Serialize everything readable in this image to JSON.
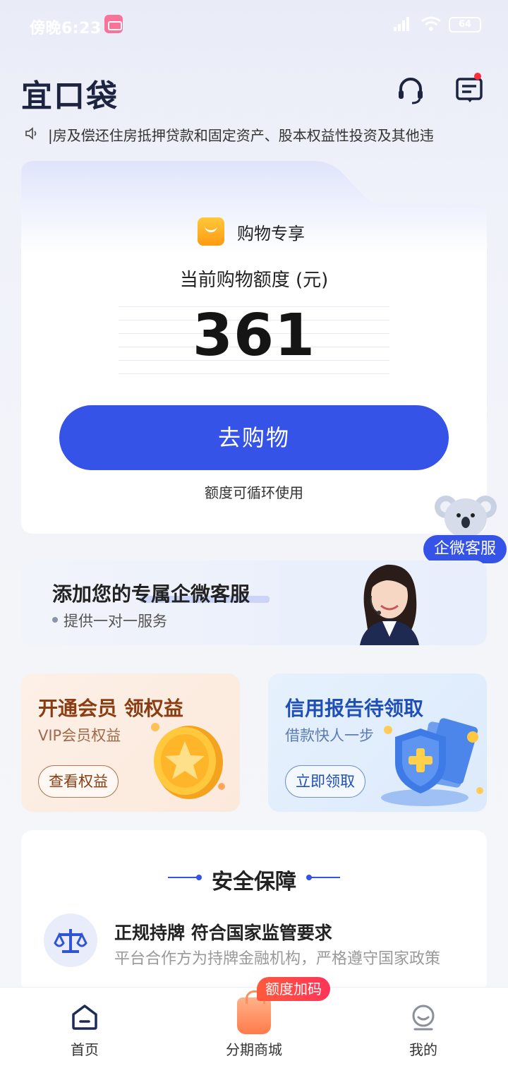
{
  "status_bar": {
    "time": "傍晚6:23",
    "battery": "64"
  },
  "header": {
    "logo": "宜口袋",
    "notice": "|房及偿还住房抵押贷款和固定资产、股本权益性投资及其他违"
  },
  "quota_card": {
    "tag": "购物专享",
    "title": "当前购物额度 (元)",
    "amount": "361",
    "button": "去购物",
    "note": "额度可循环使用"
  },
  "floating_service": {
    "label": "企微客服"
  },
  "service_banner": {
    "title": "添加您的专属企微客服",
    "subtitle": "提供一对一服务"
  },
  "promos": {
    "vip": {
      "title": "开通会员 领权益",
      "subtitle": "VIP会员权益",
      "button": "查看权益"
    },
    "credit": {
      "title": "信用报告待领取",
      "subtitle": "借款快人一步",
      "button": "立即领取"
    }
  },
  "safety": {
    "title": "安全保障",
    "item": {
      "heading": "正规持牌 符合国家监管要求",
      "desc": "平台合作方为持牌金融机构，严格遵守国家政策"
    }
  },
  "nav": {
    "badge": "额度加码",
    "items": [
      {
        "label": "首页"
      },
      {
        "label": "分期商城"
      },
      {
        "label": "我的"
      }
    ]
  },
  "colors": {
    "primary": "#3553e6",
    "badge": "#ff3d50"
  }
}
